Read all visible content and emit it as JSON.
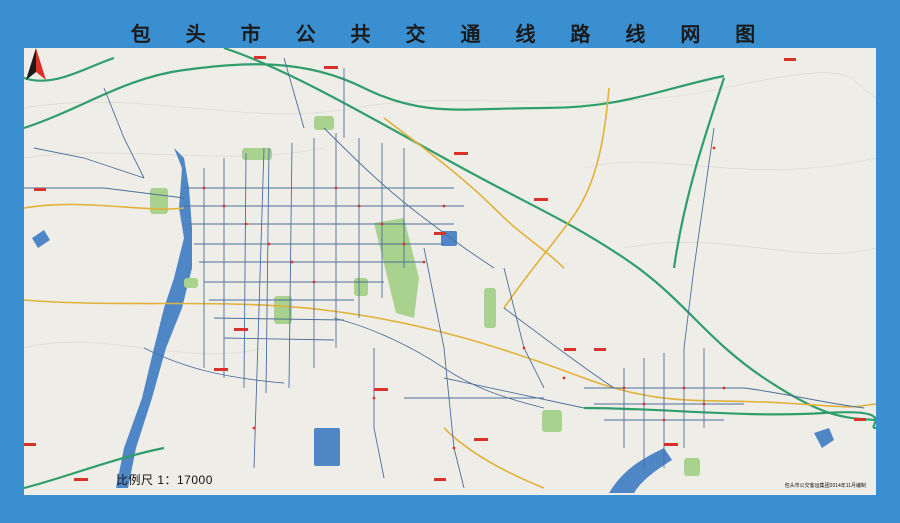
{
  "map": {
    "title": "包 头 市 公 共 交 通 线 路 线 网 图",
    "scale_label": "比例尺  1：17000",
    "credit": "包头市公交客运集团2014年11月编制",
    "north_arrow": "north-arrow-icon",
    "colors": {
      "frame": "#3a8fd0",
      "land": "#efede8",
      "water": "#4f86c6",
      "park": "#a9d28f",
      "highway": "#2f9e6a",
      "trunk": "#e0b23a",
      "bus_route": "#4c6e9a",
      "stop_label": "#d8322b"
    }
  }
}
